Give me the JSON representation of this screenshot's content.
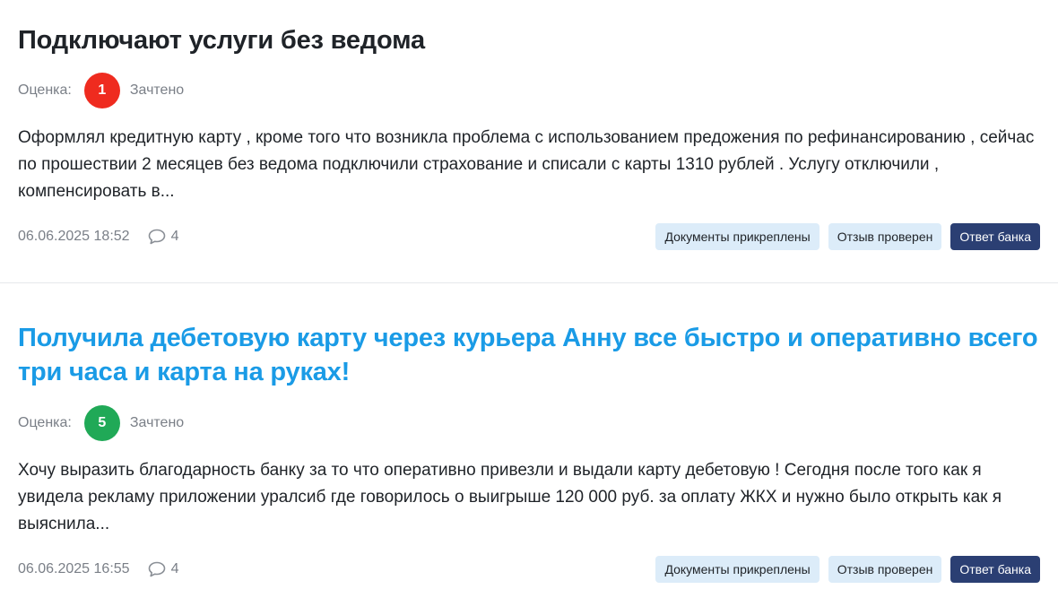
{
  "colors": {
    "grade_low": "#ef2b1f",
    "grade_high": "#20a957",
    "link_title": "#1a9be6",
    "bank_reply_tag": "#2b3f73",
    "info_tag": "#dcecf9"
  },
  "reviews": [
    {
      "title": "Подключают услуги без ведома",
      "rating_label": "Оценка:",
      "grade": "1",
      "grade_status": "Зачтено",
      "text": "Оформлял кредитную карту , кроме того что возникла проблема с использованием предожения по рефинансированию , сейчас по прошествии 2 месяцев без ведома подключили страхование и списали с карты 1310 рублей . Услугу отключили , компенсировать в...",
      "date": "06.06.2025 18:52",
      "comments": "4",
      "comment_icon": "comment-bubble-icon",
      "tags": {
        "documents": "Документы прикреплены",
        "verified": "Отзыв проверен",
        "bank_reply": "Ответ банка"
      }
    },
    {
      "title": "Получила дебетовую карту через курьера Анну все быстро и оперативно всего три часа и карта на руках!",
      "rating_label": "Оценка:",
      "grade": "5",
      "grade_status": "Зачтено",
      "text": "Хочу выразить благодарность банку за то что оперативно привезли и выдали карту дебетовую ! Сегодня после того как я увидела рекламу приложении уралсиб где говорилось о выигрыше 120 000 руб. за оплату ЖКХ и нужно было открыть как я выяснила...",
      "date": "06.06.2025 16:55",
      "comments": "4",
      "comment_icon": "comment-bubble-icon",
      "tags": {
        "documents": "Документы прикреплены",
        "verified": "Отзыв проверен",
        "bank_reply": "Ответ банка"
      }
    }
  ]
}
